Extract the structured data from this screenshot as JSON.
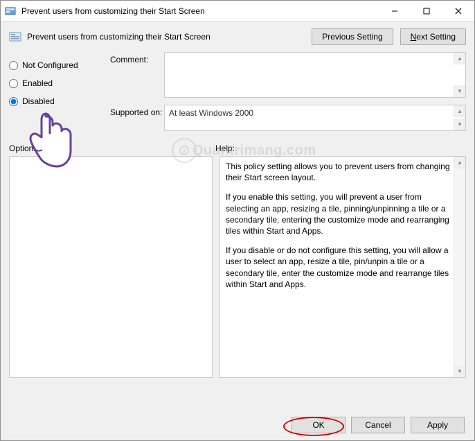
{
  "window": {
    "title": "Prevent users from customizing their Start Screen"
  },
  "header": {
    "policy_title": "Prevent users from customizing their Start Screen",
    "prev_button": "Previous Setting",
    "next_button_prefix": "N",
    "next_button_rest": "ext Setting"
  },
  "radios": {
    "not_configured": "Not Configured",
    "enabled": "Enabled",
    "disabled": "Disabled",
    "selected": "disabled"
  },
  "fields": {
    "comment_label": "Comment:",
    "comment_value": "",
    "supported_label": "Supported on:",
    "supported_value": "At least Windows 2000"
  },
  "labels": {
    "options": "Options:",
    "help": "Help:"
  },
  "help": {
    "p1": "This policy setting allows you to prevent users from changing their Start screen layout.",
    "p2": "If you enable this setting, you will prevent a user from selecting an app, resizing a tile, pinning/unpinning a tile or a secondary tile, entering the customize mode and rearranging tiles within Start and Apps.",
    "p3": "If you disable or do not configure this setting, you will allow a user to select an app, resize a tile, pin/unpin a tile or a secondary tile, enter the customize mode and rearrange tiles within Start and Apps."
  },
  "footer": {
    "ok": "OK",
    "cancel": "Cancel",
    "apply": "Apply"
  },
  "watermark": {
    "text": "Quantrimang.com"
  }
}
